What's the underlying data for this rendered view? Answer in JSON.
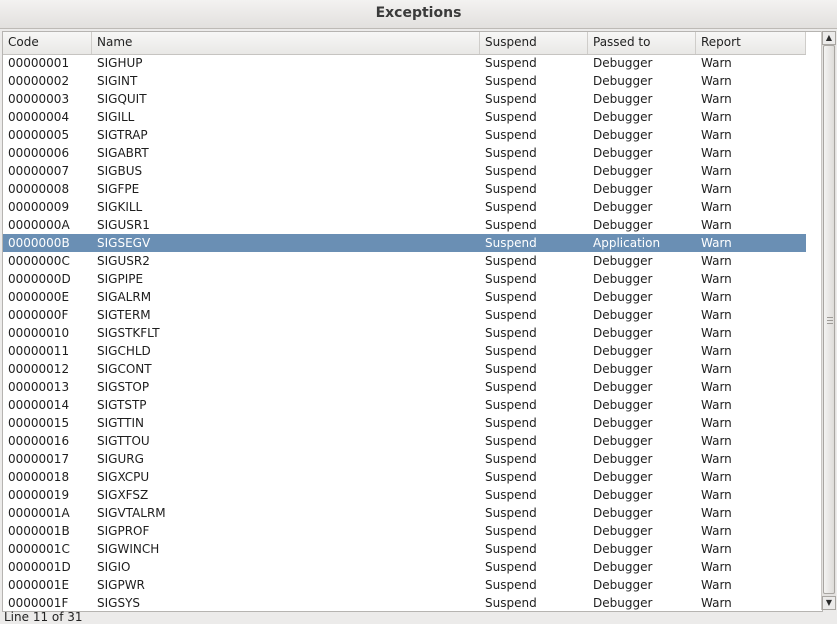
{
  "window": {
    "title": "Exceptions"
  },
  "table": {
    "columns": [
      "Code",
      "Name",
      "Suspend",
      "Passed to",
      "Report"
    ],
    "selected_index": 10,
    "rows": [
      [
        "00000001",
        "SIGHUP",
        "Suspend",
        "Debugger",
        "Warn"
      ],
      [
        "00000002",
        "SIGINT",
        "Suspend",
        "Debugger",
        "Warn"
      ],
      [
        "00000003",
        "SIGQUIT",
        "Suspend",
        "Debugger",
        "Warn"
      ],
      [
        "00000004",
        "SIGILL",
        "Suspend",
        "Debugger",
        "Warn"
      ],
      [
        "00000005",
        "SIGTRAP",
        "Suspend",
        "Debugger",
        "Warn"
      ],
      [
        "00000006",
        "SIGABRT",
        "Suspend",
        "Debugger",
        "Warn"
      ],
      [
        "00000007",
        "SIGBUS",
        "Suspend",
        "Debugger",
        "Warn"
      ],
      [
        "00000008",
        "SIGFPE",
        "Suspend",
        "Debugger",
        "Warn"
      ],
      [
        "00000009",
        "SIGKILL",
        "Suspend",
        "Debugger",
        "Warn"
      ],
      [
        "0000000A",
        "SIGUSR1",
        "Suspend",
        "Debugger",
        "Warn"
      ],
      [
        "0000000B",
        "SIGSEGV",
        "Suspend",
        "Application",
        "Warn"
      ],
      [
        "0000000C",
        "SIGUSR2",
        "Suspend",
        "Debugger",
        "Warn"
      ],
      [
        "0000000D",
        "SIGPIPE",
        "Suspend",
        "Debugger",
        "Warn"
      ],
      [
        "0000000E",
        "SIGALRM",
        "Suspend",
        "Debugger",
        "Warn"
      ],
      [
        "0000000F",
        "SIGTERM",
        "Suspend",
        "Debugger",
        "Warn"
      ],
      [
        "00000010",
        "SIGSTKFLT",
        "Suspend",
        "Debugger",
        "Warn"
      ],
      [
        "00000011",
        "SIGCHLD",
        "Suspend",
        "Debugger",
        "Warn"
      ],
      [
        "00000012",
        "SIGCONT",
        "Suspend",
        "Debugger",
        "Warn"
      ],
      [
        "00000013",
        "SIGSTOP",
        "Suspend",
        "Debugger",
        "Warn"
      ],
      [
        "00000014",
        "SIGTSTP",
        "Suspend",
        "Debugger",
        "Warn"
      ],
      [
        "00000015",
        "SIGTTIN",
        "Suspend",
        "Debugger",
        "Warn"
      ],
      [
        "00000016",
        "SIGTTOU",
        "Suspend",
        "Debugger",
        "Warn"
      ],
      [
        "00000017",
        "SIGURG",
        "Suspend",
        "Debugger",
        "Warn"
      ],
      [
        "00000018",
        "SIGXCPU",
        "Suspend",
        "Debugger",
        "Warn"
      ],
      [
        "00000019",
        "SIGXFSZ",
        "Suspend",
        "Debugger",
        "Warn"
      ],
      [
        "0000001A",
        "SIGVTALRM",
        "Suspend",
        "Debugger",
        "Warn"
      ],
      [
        "0000001B",
        "SIGPROF",
        "Suspend",
        "Debugger",
        "Warn"
      ],
      [
        "0000001C",
        "SIGWINCH",
        "Suspend",
        "Debugger",
        "Warn"
      ],
      [
        "0000001D",
        "SIGIO",
        "Suspend",
        "Debugger",
        "Warn"
      ],
      [
        "0000001E",
        "SIGPWR",
        "Suspend",
        "Debugger",
        "Warn"
      ],
      [
        "0000001F",
        "SIGSYS",
        "Suspend",
        "Debugger",
        "Warn"
      ]
    ]
  },
  "colors": {
    "selection": "#6a8fb4"
  },
  "scrollbar": {
    "up_icon": "arrow-up-icon",
    "down_icon": "arrow-down-icon"
  },
  "status": {
    "text": "Line 11 of 31"
  }
}
